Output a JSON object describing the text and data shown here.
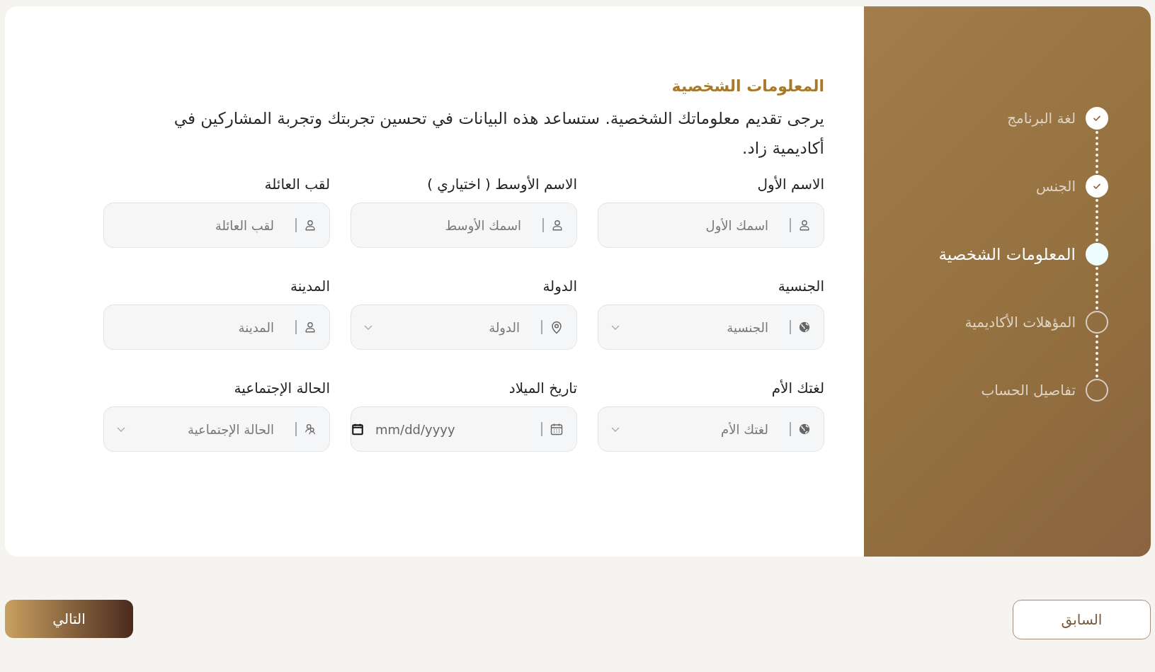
{
  "steps": [
    {
      "label": "لغة البرنامج",
      "completed": true,
      "selected": false
    },
    {
      "label": "الجنس",
      "completed": true,
      "selected": false
    },
    {
      "label": "المعلومات الشخصية",
      "completed": false,
      "selected": true
    },
    {
      "label": "المؤهلات الأكاديمية",
      "completed": false,
      "selected": false
    },
    {
      "label": "تفاصيل الحساب",
      "completed": false,
      "selected": false
    }
  ],
  "form": {
    "title": "المعلومات الشخصية",
    "description": "يرجى تقديم معلوماتك الشخصية. ستساعد هذه البيانات في تحسين تجربتك وتجربة المشاركين في أكاديمية زاد.",
    "fields": [
      {
        "label": "الاسم الأول",
        "placeholder": "اسمك الأول",
        "kind": "text"
      },
      {
        "label": "الاسم الأوسط ( اختياري )",
        "placeholder": "اسمك الأوسط",
        "kind": "text"
      },
      {
        "label": "لقب العائلة",
        "placeholder": "لقب العائلة",
        "kind": "text"
      },
      {
        "label": "الجنسية",
        "placeholder": "الجنسية",
        "kind": "select"
      },
      {
        "label": "الدولة",
        "placeholder": "الدولة",
        "kind": "select"
      },
      {
        "label": "المدينة",
        "placeholder": "المدينة",
        "kind": "text"
      },
      {
        "label": "لغتك الأم",
        "placeholder": "لغتك الأم",
        "kind": "select"
      },
      {
        "label": "تاريخ الميلاد",
        "placeholder": "mm/dd/yyyy",
        "kind": "date"
      },
      {
        "label": "الحالة الإجتماعية",
        "placeholder": "الحالة الإجتماعية",
        "kind": "select"
      }
    ]
  },
  "buttons": {
    "previous": "السابق",
    "next": "التالي"
  }
}
